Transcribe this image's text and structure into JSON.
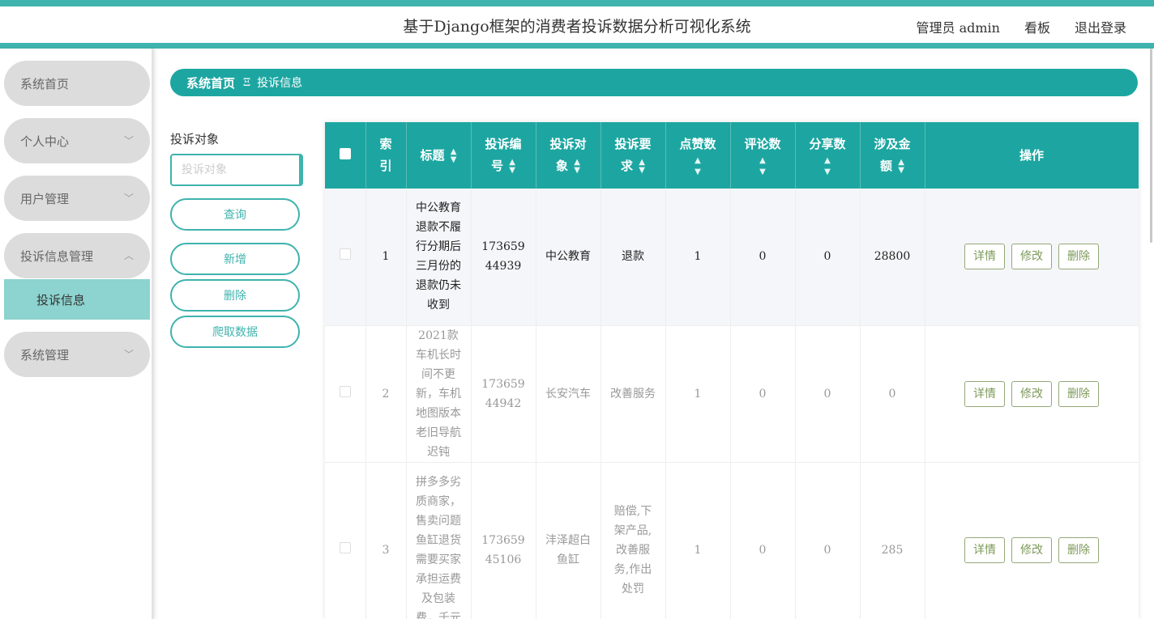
{
  "header": {
    "title": "基于Django框架的消费者投诉数据分析可视化系统",
    "admin_label": "管理员 admin",
    "board_label": "看板",
    "logout_label": "退出登录"
  },
  "sidebar": {
    "items": [
      {
        "label": "系统首页"
      },
      {
        "label": "个人中心"
      },
      {
        "label": "用户管理"
      },
      {
        "label": "投诉信息管理"
      },
      {
        "label": "系统管理"
      }
    ],
    "sub_active": "投诉信息"
  },
  "breadcrumb": {
    "home": "系统首页",
    "separator": "Ξ",
    "current": "投诉信息"
  },
  "search": {
    "label": "投诉对象",
    "placeholder": "投诉对象",
    "query_button": "查询",
    "add_button": "新增",
    "delete_button": "删除",
    "crawl_button": "爬取数据"
  },
  "table": {
    "headers": {
      "index": "索引",
      "title": "标题",
      "number": "投诉编号",
      "target": "投诉对象",
      "demand": "投诉要求",
      "likes": "点赞数",
      "comments": "评论数",
      "shares": "分享数",
      "amount": "涉及金额",
      "actions": "操作"
    },
    "rows": [
      {
        "index": "1",
        "title": "中公教育退款不履行分期后三月份的退款仍未收到",
        "number": "17365944939",
        "target": "中公教育",
        "demand": "退款",
        "likes": "1",
        "comments": "0",
        "shares": "0",
        "amount": "28800"
      },
      {
        "index": "2",
        "title": "2021款车机长时间不更新，车机地图版本老旧导航迟钝",
        "number": "17365944942",
        "target": "长安汽车",
        "demand": "改善服务",
        "likes": "1",
        "comments": "0",
        "shares": "0",
        "amount": "0"
      },
      {
        "index": "3",
        "title": "拼多多劣质商家，售卖问题鱼缸退货需要买家承担运费及包装费，千元",
        "number": "17365945106",
        "target": "沣泽超白鱼缸",
        "demand": "赔偿,下架产品,改善服务,作出处罚",
        "likes": "1",
        "comments": "0",
        "shares": "0",
        "amount": "285"
      }
    ],
    "action_labels": {
      "detail": "详情",
      "edit": "修改",
      "delete": "删除"
    }
  },
  "colors": {
    "accent": "#1da6a1",
    "accent_light": "#8dd3cf",
    "action_border": "#93a878"
  }
}
